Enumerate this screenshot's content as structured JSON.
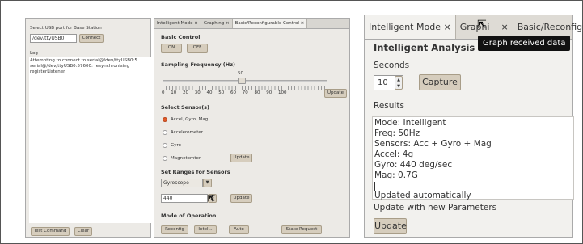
{
  "p1": {
    "usb_label": "Select USB port for Base Station",
    "port_value": "/dev/ttyUSB0",
    "connect": "Connect",
    "log_label": "Log",
    "log_lines": [
      "Attempting to connect to serial@/dev/ttyUSB0:5",
      "serial@/dev/ttyUSB0:57600: resynchronising",
      "registerListener"
    ],
    "test_command": "Test Command",
    "clear": "Clear"
  },
  "p2": {
    "tabs": [
      "Intelligent Mode ×",
      "Graphing ×",
      "Basic/Reconfigurable Control ×"
    ],
    "basic_control": "Basic Control",
    "on": "ON",
    "off": "OFF",
    "sampling": "Sampling Frequency (Hz)",
    "slider_value": "50",
    "slider_fraction": 0.5,
    "ticks": [
      "0",
      "10",
      "20",
      "30",
      "40",
      "50",
      "60",
      "70",
      "80",
      "90",
      "100"
    ],
    "update": "Update",
    "select_sensors": "Select Sensor(s)",
    "sensors": [
      "Accel, Gyro, Mag",
      "Accelerometer",
      "Gyro",
      "Magnetomter"
    ],
    "set_ranges": "Set Ranges for Sensors",
    "range_sensor": "Gyroscope",
    "range_value": "440",
    "mode_op": "Mode of Operation",
    "modes": [
      "Reconfig",
      "Intell..",
      "Auto",
      "State Request"
    ]
  },
  "p3": {
    "tabs": [
      "Intelligent Mode ×",
      "Graphi",
      "×",
      "Basic/Reconfigura"
    ],
    "heading": "Intelligent Analysis",
    "seconds": "Seconds",
    "seconds_value": "10",
    "capture": "Capture",
    "results": "Results",
    "result_lines": [
      "Mode: Intelligent",
      "Freq: 50Hz",
      "Sensors: Acc + Gyro + Mag",
      "Accel: 4g",
      "Gyro: 440 deg/sec",
      "Mag: 0.7G"
    ],
    "updated": "Updated automatically",
    "update_with": "Update with new Parameters",
    "update": "Update",
    "tooltip": "Graph received data"
  }
}
